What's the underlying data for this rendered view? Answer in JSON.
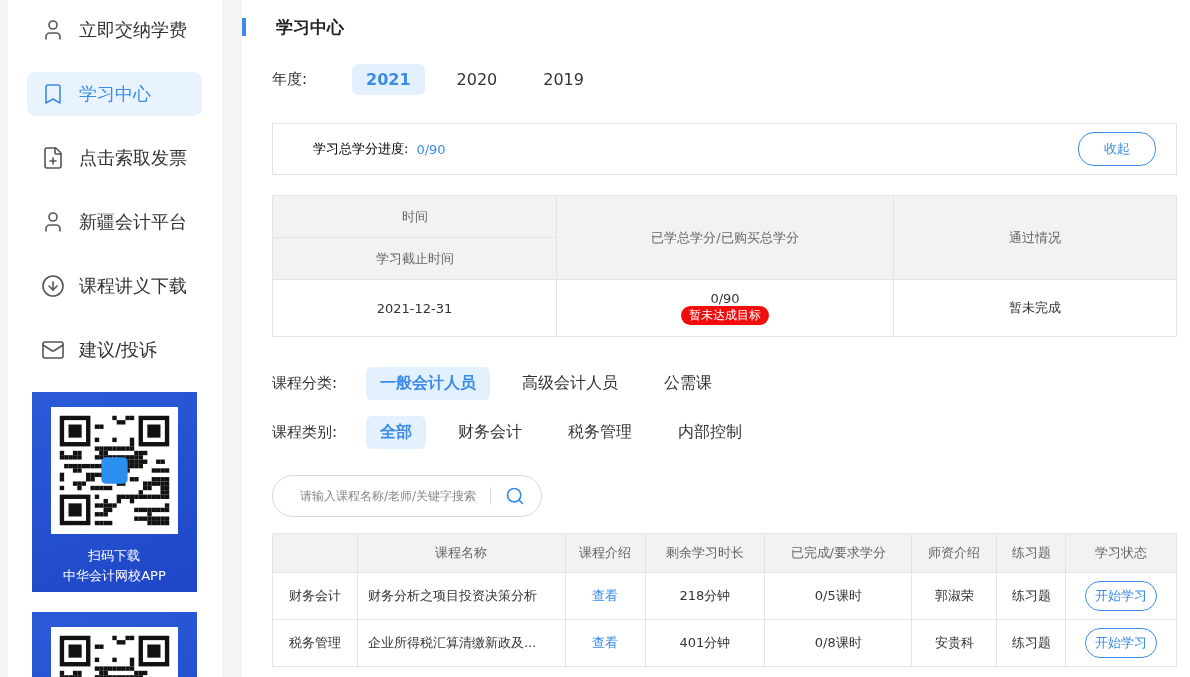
{
  "sidebar": {
    "items": [
      {
        "label": "立即交纳学费",
        "selected": false
      },
      {
        "label": "学习中心",
        "selected": true
      },
      {
        "label": "点击索取发票",
        "selected": false
      },
      {
        "label": "新疆会计平台",
        "selected": false
      },
      {
        "label": "课程讲义下载",
        "selected": false
      },
      {
        "label": "建议/投诉",
        "selected": false
      }
    ],
    "app_cards": [
      {
        "kind": "captioned",
        "caption": [
          "扫码下载",
          "中华会计网校APP"
        ]
      },
      {
        "kind": "plain"
      }
    ]
  },
  "page_title": "学习中心",
  "year_filter": {
    "label": "年度:",
    "options": [
      {
        "label": "2021",
        "selected": true
      },
      {
        "label": "2020",
        "selected": false
      },
      {
        "label": "2019",
        "selected": false
      }
    ]
  },
  "progress": {
    "label": "学习总学分进度:",
    "value": "0/90",
    "button": "收起"
  },
  "summary_table": {
    "headers": {
      "time": "时间",
      "deadline": "学习截止时间",
      "credits": "已学总学分/已购买总学分",
      "status": "通过情况"
    },
    "rows": [
      {
        "deadline": "2021-12-31",
        "credits": "0/90",
        "badge": "暂未达成目标",
        "status": "暂未完成"
      }
    ]
  },
  "filters": [
    {
      "label": "课程分类:",
      "options": [
        {
          "label": "一般会计人员",
          "selected": true
        },
        {
          "label": "高级会计人员",
          "selected": false
        },
        {
          "label": "公需课",
          "selected": false
        }
      ]
    },
    {
      "label": "课程类别:",
      "options": [
        {
          "label": "全部",
          "selected": true
        },
        {
          "label": "财务会计",
          "selected": false
        },
        {
          "label": "税务管理",
          "selected": false
        },
        {
          "label": "内部控制",
          "selected": false
        }
      ]
    }
  ],
  "search": {
    "placeholder": "请输入课程名称/老师/关键字搜索"
  },
  "course_table": {
    "columns": [
      "课程名称",
      "课程介绍",
      "剩余学习时长",
      "已完成/要求学分",
      "师资介绍",
      "练习题",
      "学习状态"
    ],
    "rows": [
      {
        "category": "财务会计",
        "name": "财务分析之项目投资决策分析",
        "intro": "查看",
        "remaining": "218分钟",
        "completed": "0/5课时",
        "teacher": "郭淑荣",
        "exercise": "练习题",
        "action": "开始学习"
      },
      {
        "category": "税务管理",
        "name": "企业所得税汇算清缴新政及...",
        "intro": "查看",
        "remaining": "401分钟",
        "completed": "0/8课时",
        "teacher": "安贵科",
        "exercise": "练习题",
        "action": "开始学习"
      }
    ]
  }
}
